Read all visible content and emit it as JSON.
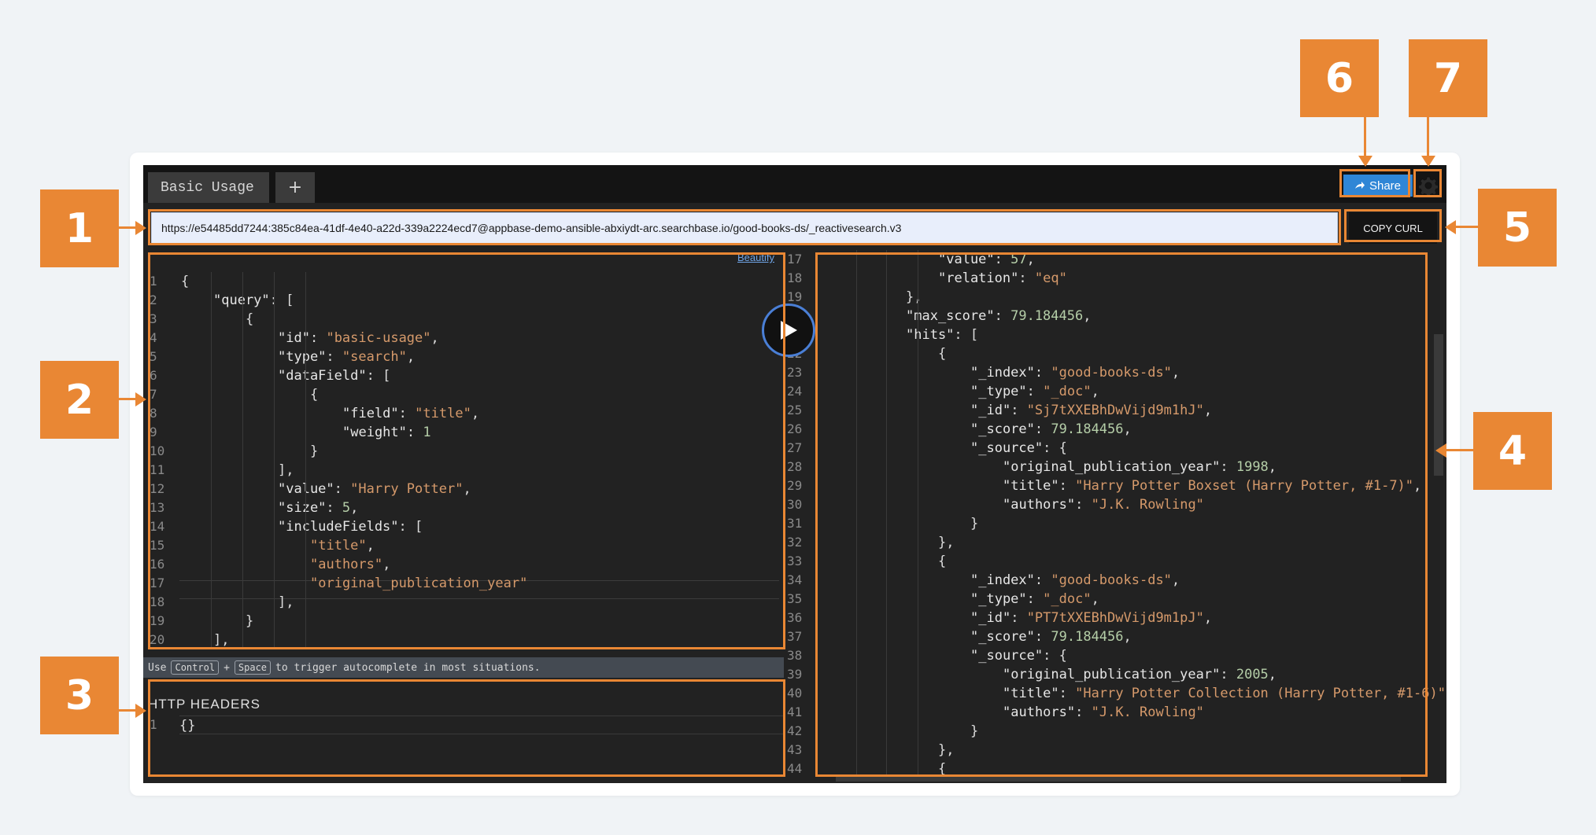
{
  "tabs": [
    {
      "label": "Basic Usage"
    },
    {
      "label": "+"
    }
  ],
  "share_label": "Share",
  "url": "https://e54485dd7244:385c84ea-41df-4e40-a22d-339a2224ecd7@appbase-demo-ansible-abxiydt-arc.searchbase.io/good-books-ds/_reactivesearch.v3",
  "copy_curl_label": "COPY CURL",
  "beautify_label": "Beautify",
  "hint": {
    "prefix": "Use",
    "key1": "Control",
    "plus": "+",
    "key2": "Space",
    "suffix": "to trigger autocomplete in most situations."
  },
  "http_headers": {
    "title": "HTTP HEADERS",
    "line_number": "1",
    "value": "{}"
  },
  "query_editor": {
    "line_numbers": [
      "1",
      "2",
      "3",
      "4",
      "5",
      "6",
      "7",
      "8",
      "9",
      "10",
      "11",
      "12",
      "13",
      "14",
      "15",
      "16",
      "17",
      "18",
      "19",
      "20"
    ],
    "lines": [
      "{",
      "    \"query\": [",
      "        {",
      "            \"id\": \"basic-usage\",",
      "            \"type\": \"search\",",
      "            \"dataField\": [",
      "                {",
      "                    \"field\": \"title\",",
      "                    \"weight\": 1",
      "                }",
      "            ],",
      "            \"value\": \"Harry Potter\",",
      "            \"size\": 5,",
      "            \"includeFields\": [",
      "                \"title\",",
      "                \"authors\",",
      "                \"original_publication_year\"",
      "            ],",
      "        }",
      "    ],"
    ]
  },
  "result_editor": {
    "line_numbers": [
      "17",
      "18",
      "19",
      "20",
      "21",
      "22",
      "23",
      "24",
      "25",
      "26",
      "27",
      "28",
      "29",
      "30",
      "31",
      "32",
      "33",
      "34",
      "35",
      "36",
      "37",
      "38",
      "39",
      "40",
      "41",
      "42",
      "43",
      "44"
    ],
    "lines": [
      "                \"value\": 57,",
      "                \"relation\": \"eq\"",
      "            },",
      "            \"max_score\": 79.184456,",
      "            \"hits\": [",
      "                {",
      "                    \"_index\": \"good-books-ds\",",
      "                    \"_type\": \"_doc\",",
      "                    \"_id\": \"Sj7tXXEBhDwVijd9m1hJ\",",
      "                    \"_score\": 79.184456,",
      "                    \"_source\": {",
      "                        \"original_publication_year\": 1998,",
      "                        \"title\": \"Harry Potter Boxset (Harry Potter, #1-7)\",",
      "                        \"authors\": \"J.K. Rowling\"",
      "                    }",
      "                },",
      "                {",
      "                    \"_index\": \"good-books-ds\",",
      "                    \"_type\": \"_doc\",",
      "                    \"_id\": \"PT7tXXEBhDwVijd9m1pJ\",",
      "                    \"_score\": 79.184456,",
      "                    \"_source\": {",
      "                        \"original_publication_year\": 2005,",
      "                        \"title\": \"Harry Potter Collection (Harry Potter, #1-6)\",",
      "                        \"authors\": \"J.K. Rowling\"",
      "                    }",
      "                },",
      "                {"
    ]
  },
  "callouts": [
    "1",
    "2",
    "3",
    "4",
    "5",
    "6",
    "7"
  ],
  "colors": {
    "callout": "#e98734",
    "share_button": "#2f86d6",
    "url_bar": "#e8eefb",
    "editor_bg": "#222222",
    "string": "#d69a6b",
    "number": "#b5cea8"
  },
  "icons": {
    "share": "share-arrow-icon",
    "settings": "gear-icon",
    "run": "play-icon"
  }
}
